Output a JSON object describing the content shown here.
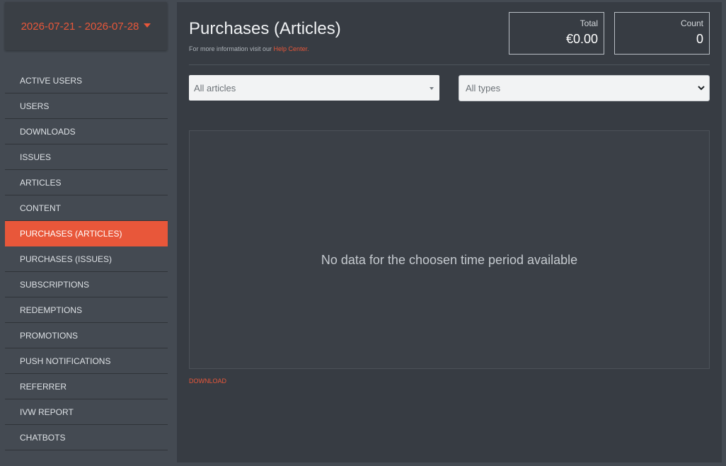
{
  "date_picker": {
    "range": "2026-07-21 - 2026-07-28",
    "icon": "caret-down-icon"
  },
  "sidebar": {
    "active": "PURCHASES (ARTICLES)",
    "items": [
      {
        "label": "ACTIVE USERS"
      },
      {
        "label": "USERS"
      },
      {
        "label": "DOWNLOADS"
      },
      {
        "label": "ISSUES"
      },
      {
        "label": "ARTICLES"
      },
      {
        "label": "CONTENT"
      },
      {
        "label": "PURCHASES (ARTICLES)"
      },
      {
        "label": "PURCHASES (ISSUES)"
      },
      {
        "label": "SUBSCRIPTIONS"
      },
      {
        "label": "REDEMPTIONS"
      },
      {
        "label": "PROMOTIONS"
      },
      {
        "label": "PUSH NOTIFICATIONS"
      },
      {
        "label": "REFERRER"
      },
      {
        "label": "IVW REPORT"
      },
      {
        "label": "CHATBOTS"
      }
    ]
  },
  "header": {
    "title": "Purchases (Articles)",
    "help_prefix": "For more information visit our ",
    "help_link": "Help Center."
  },
  "stats": {
    "total_label": "Total",
    "total_value": "€0.00",
    "count_label": "Count",
    "count_value": "0"
  },
  "filters": {
    "articles_placeholder": "All articles",
    "types_selected": "All types"
  },
  "chart": {
    "empty_message": "No data for the choosen time period available"
  },
  "download_label": "DOWNLOAD",
  "colors": {
    "accent": "#e8573a",
    "background": "#444a52",
    "panel": "#373c43",
    "sidebar_item_text": "#dde1e5"
  }
}
